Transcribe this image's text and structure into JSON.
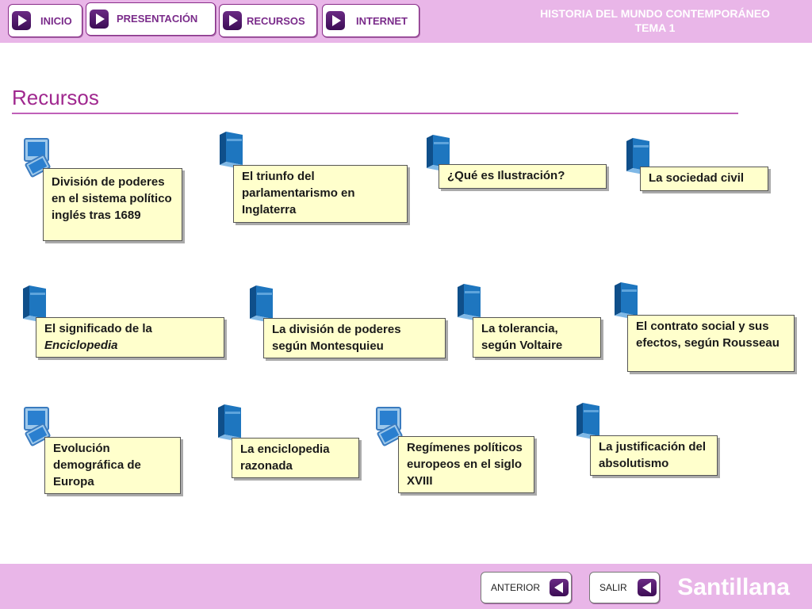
{
  "nav": {
    "inicio": "INICIO",
    "presentacion": "PRESENTACIÓN",
    "recursos": "RECURSOS",
    "internet": "INTERNET"
  },
  "header": {
    "line1": "HISTORIA DEL MUNDO CONTEMPORÁNEO",
    "line2": "TEMA 1"
  },
  "page": {
    "title": "Recursos"
  },
  "resources": {
    "r1": {
      "text": "División de poderes en el sistema político inglés tras 1689",
      "icon": "presentation-icon"
    },
    "r2": {
      "text": "El triunfo del parlamentarismo en Inglaterra",
      "icon": "book-icon"
    },
    "r3": {
      "text": "¿Qué es Ilustración?",
      "icon": "book-icon"
    },
    "r4": {
      "text": "La sociedad civil",
      "icon": "book-icon"
    },
    "r5": {
      "text_plain": "El significado de la",
      "text_italic": "Enciclopedia",
      "icon": "book-icon"
    },
    "r6": {
      "text": "La división de poderes según Montesquieu",
      "icon": "book-icon"
    },
    "r7": {
      "text": "La tolerancia, según Voltaire",
      "icon": "book-icon"
    },
    "r8": {
      "text": "El contrato social y sus efectos, según Rousseau",
      "icon": "book-icon"
    },
    "r9": {
      "text": "Evolución demográfica de Europa",
      "icon": "presentation-icon"
    },
    "r10": {
      "text": "La enciclopedia razonada",
      "icon": "book-icon"
    },
    "r11": {
      "text": "Regímenes políticos europeos en el siglo XVIII",
      "icon": "presentation-icon"
    },
    "r12": {
      "text": "La justificación del absolutismo",
      "icon": "book-icon"
    }
  },
  "footer": {
    "anterior": "ANTERIOR",
    "salir": "SALIR",
    "brand": "Santillana"
  }
}
